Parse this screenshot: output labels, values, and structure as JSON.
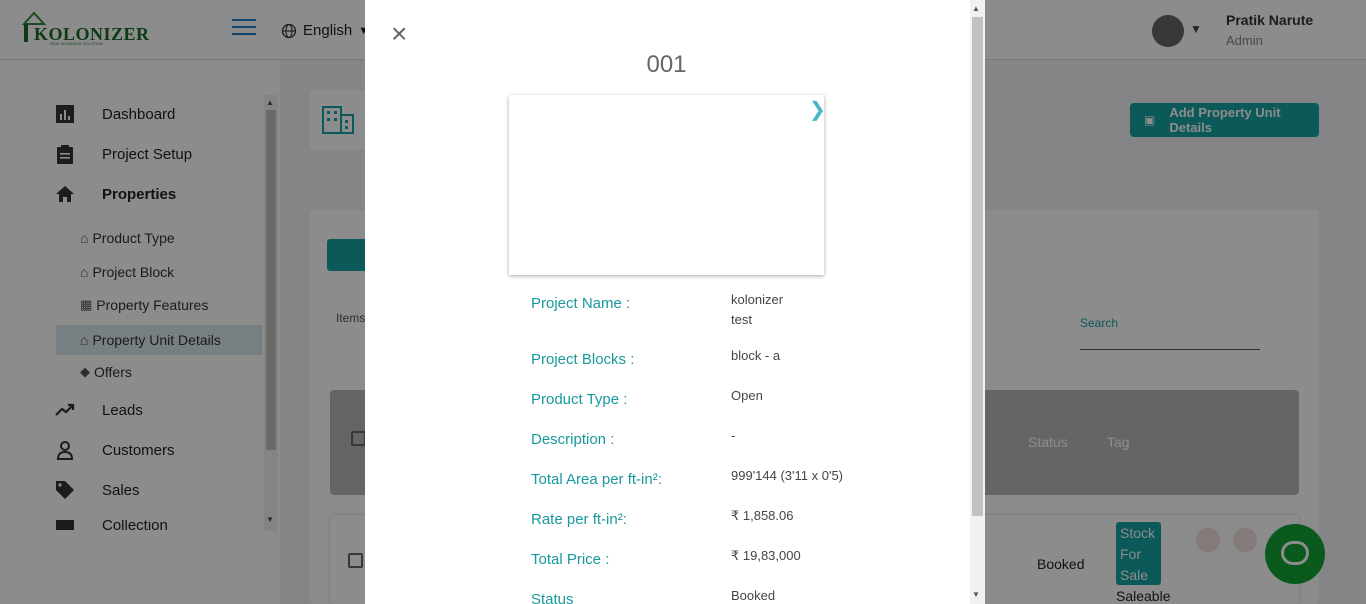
{
  "header": {
    "logo_text": "KOLONIZER",
    "logo_tagline": "REAL BUSINESS SOLUTION",
    "language": "English",
    "user_name": "Pratik Narute",
    "user_role": "Admin"
  },
  "sidebar": {
    "items": [
      {
        "label": "Dashboard",
        "icon": "chart-icon"
      },
      {
        "label": "Project Setup",
        "icon": "clipboard-icon"
      },
      {
        "label": "Properties",
        "icon": "home-icon"
      },
      {
        "label": "Leads",
        "icon": "trending-icon"
      },
      {
        "label": "Customers",
        "icon": "person-icon"
      },
      {
        "label": "Sales",
        "icon": "tag-icon"
      },
      {
        "label": "Collection",
        "icon": "briefcase-icon"
      }
    ],
    "sub_items": [
      {
        "label": "Product Type",
        "icon": "home-icon"
      },
      {
        "label": "Project Block",
        "icon": "home-icon"
      },
      {
        "label": "Property Features",
        "icon": "gift-icon"
      },
      {
        "label": "Property Unit Details",
        "icon": "home-icon"
      },
      {
        "label": "Offers",
        "icon": "tags-icon"
      }
    ]
  },
  "main": {
    "add_button": "Add Property Unit Details",
    "items_label": "Items",
    "search_label": "Search",
    "columns": [
      "Status",
      "Tag"
    ],
    "row": {
      "status": "Booked",
      "badge": "Stock For Sale",
      "tag": "Saleable"
    }
  },
  "modal": {
    "close": "×",
    "title": "001",
    "fields": [
      {
        "label": "Project Name :",
        "value": "kolonizer test"
      },
      {
        "label": "Project Blocks :",
        "value": "block - a"
      },
      {
        "label": "Product Type :",
        "value": "Open"
      },
      {
        "label": "Description :",
        "value": "-"
      },
      {
        "label": "Total Area per ft-in²:",
        "value": "999'144 (3'11 x 0'5)"
      },
      {
        "label": "Rate per ft-in²:",
        "value": "₹ 1,858.06"
      },
      {
        "label": "Total Price :",
        "value": "₹ 19,83,000"
      },
      {
        "label": "Status",
        "value": "Booked"
      }
    ]
  },
  "colors": {
    "accent": "#17a2a2",
    "label": "#17999e",
    "chat": "#13a538"
  }
}
